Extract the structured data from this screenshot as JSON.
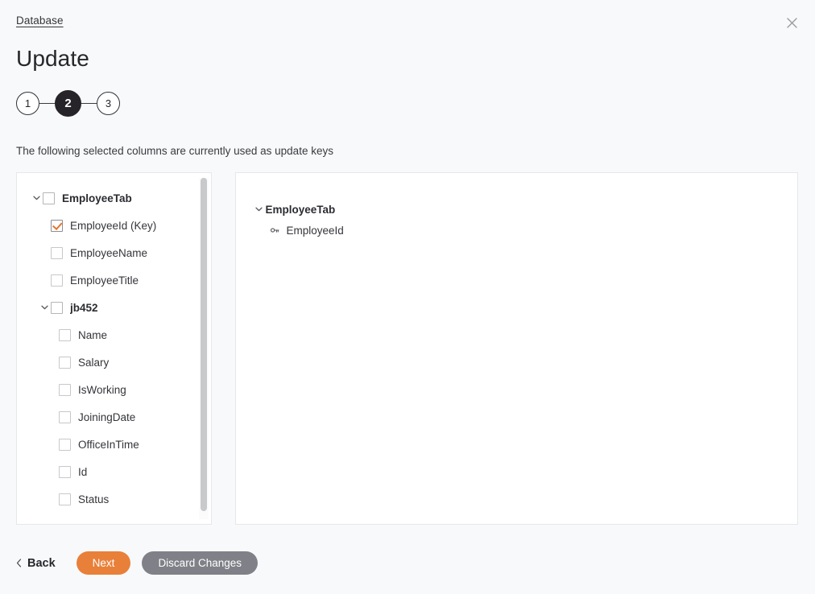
{
  "breadcrumb": {
    "label": "Database"
  },
  "header": {
    "title": "Update",
    "close_icon": "close-icon"
  },
  "stepper": {
    "steps": [
      {
        "label": "1",
        "active": false
      },
      {
        "label": "2",
        "active": true
      },
      {
        "label": "3",
        "active": false
      }
    ]
  },
  "instruction": {
    "text": "The following selected columns are currently used as update keys"
  },
  "left_panel": {
    "tree": [
      {
        "label": "EmployeeTab",
        "indent": 0,
        "chevron": "chevron-down-icon",
        "checkbox": "unchecked",
        "bold": true
      },
      {
        "label": "EmployeeId (Key)",
        "indent": 1,
        "chevron": "",
        "checkbox": "checked",
        "bold": false
      },
      {
        "label": "EmployeeName",
        "indent": 1,
        "chevron": "",
        "checkbox": "unchecked",
        "bold": false
      },
      {
        "label": "EmployeeTitle",
        "indent": 1,
        "chevron": "",
        "checkbox": "unchecked",
        "bold": false
      },
      {
        "label": "jb452",
        "indent": 1,
        "chevron": "chevron-down-icon",
        "checkbox": "unchecked",
        "bold": true
      },
      {
        "label": "Name",
        "indent": 2,
        "chevron": "",
        "checkbox": "unchecked",
        "bold": false
      },
      {
        "label": "Salary",
        "indent": 2,
        "chevron": "",
        "checkbox": "unchecked",
        "bold": false
      },
      {
        "label": "IsWorking",
        "indent": 2,
        "chevron": "",
        "checkbox": "unchecked",
        "bold": false
      },
      {
        "label": "JoiningDate",
        "indent": 2,
        "chevron": "",
        "checkbox": "unchecked",
        "bold": false
      },
      {
        "label": "OfficeInTime",
        "indent": 2,
        "chevron": "",
        "checkbox": "unchecked",
        "bold": false
      },
      {
        "label": "Id",
        "indent": 2,
        "chevron": "",
        "checkbox": "unchecked",
        "bold": false
      },
      {
        "label": "Status",
        "indent": 2,
        "chevron": "",
        "checkbox": "unchecked",
        "bold": false
      }
    ]
  },
  "right_panel": {
    "tree": [
      {
        "label": "EmployeeTab",
        "indent": 0,
        "icon": "chevron-down-icon",
        "bold": true
      },
      {
        "label": "EmployeeId",
        "indent": 1,
        "icon": "key-icon",
        "bold": false
      }
    ]
  },
  "footer": {
    "back_label": "Back",
    "back_icon": "chevron-left-icon",
    "next_label": "Next",
    "discard_label": "Discard Changes"
  },
  "colors": {
    "accent": "#e8803a",
    "discard": "#7f8088",
    "active_step": "#262428",
    "background": "#f8f9fa",
    "panel": "#ffffff"
  }
}
